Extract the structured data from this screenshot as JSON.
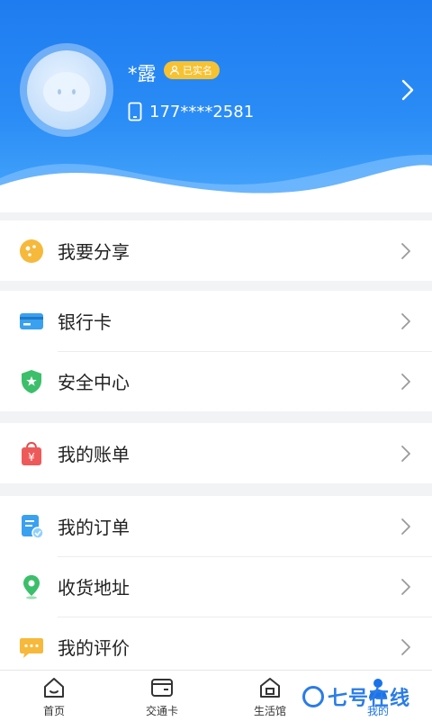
{
  "profile": {
    "name": "*露",
    "verified_label": "已实名",
    "phone": "177****2581"
  },
  "menu": {
    "share": "我要分享",
    "bank_card": "银行卡",
    "security_center": "安全中心",
    "my_bill": "我的账单",
    "my_orders": "我的订单",
    "shipping_address": "收货地址",
    "my_reviews": "我的评价"
  },
  "nav": {
    "home": "首页",
    "transit_card": "交通卡",
    "life_hall": "生活馆",
    "mine": "我的"
  },
  "watermark": "七号在线",
  "colors": {
    "primary": "#1f7cf0",
    "verified_badge": "#f7c232",
    "active_nav": "#1a73e8"
  }
}
